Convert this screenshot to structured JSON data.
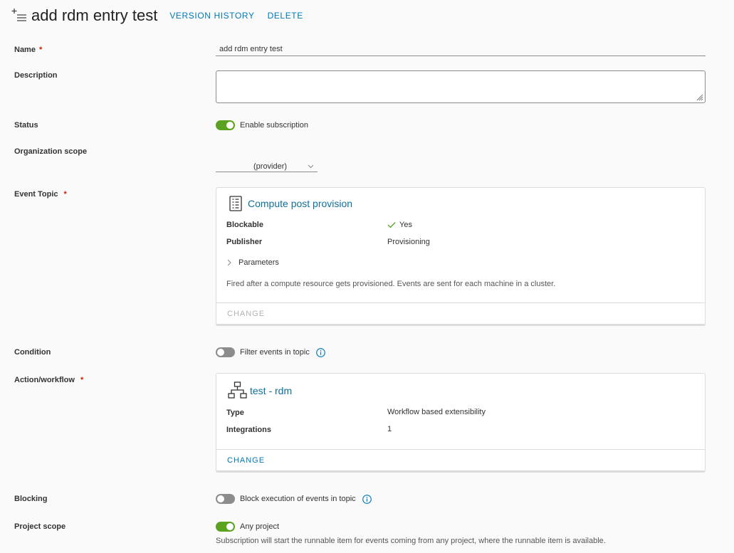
{
  "header": {
    "title": "add rdm entry test",
    "version_history": "VERSION HISTORY",
    "delete": "DELETE"
  },
  "form": {
    "name_label": "Name",
    "name_value": "add rdm entry test",
    "required_mark": "*",
    "description_label": "Description",
    "description_value": "",
    "status_label": "Status",
    "status_toggle_label": "Enable subscription",
    "status_enabled": true,
    "org_scope_label": "Organization scope",
    "org_scope_value": "(provider)",
    "event_topic_label": "Event Topic",
    "condition_label": "Condition",
    "condition_toggle_label": "Filter events in topic",
    "condition_enabled": false,
    "action_label": "Action/workflow",
    "blocking_label": "Blocking",
    "blocking_toggle_label": "Block execution of events in topic",
    "blocking_enabled": false,
    "project_scope_label": "Project scope",
    "project_scope_toggle_label": "Any project",
    "project_scope_enabled": true,
    "project_scope_description": "Subscription will start the runnable item for events coming from any project, where the runnable item is available."
  },
  "event_topic": {
    "title": "Compute post provision",
    "blockable_label": "Blockable",
    "blockable_value": "Yes",
    "publisher_label": "Publisher",
    "publisher_value": "Provisioning",
    "parameters_label": "Parameters",
    "description": "Fired after a compute resource gets provisioned. Events are sent for each machine in a cluster.",
    "change_label": "CHANGE"
  },
  "action": {
    "title": "test - rdm",
    "type_label": "Type",
    "type_value": "Workflow based extensibility",
    "integrations_label": "Integrations",
    "integrations_value": "1",
    "change_label": "CHANGE"
  },
  "colors": {
    "accent": "#0079b8",
    "toggle_on": "#5aa220",
    "toggle_off": "#8c8c8c",
    "required": "#c92100"
  }
}
